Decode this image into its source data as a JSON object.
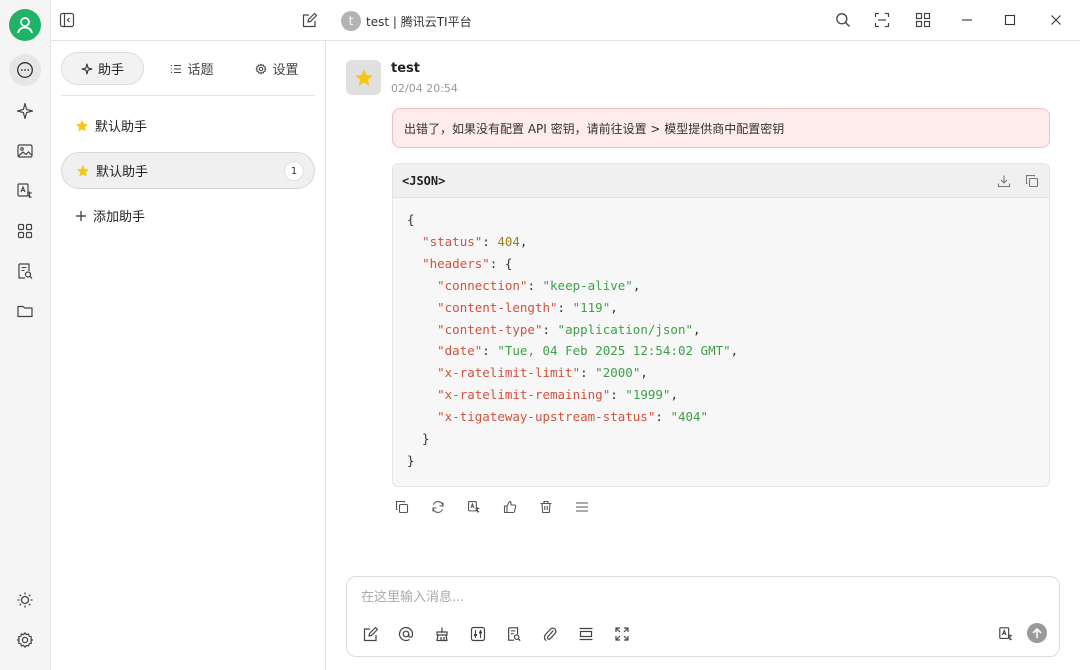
{
  "window": {
    "title": "test | 腾讯云TI平台",
    "title_avatar_letter": "t"
  },
  "rail": {
    "items": [
      "chat-icon",
      "sparkle-icon",
      "image-icon",
      "translate-icon",
      "apps-icon",
      "file-search-icon",
      "folder-icon"
    ],
    "bottom": [
      "sun-icon",
      "gear-icon"
    ]
  },
  "tabs": [
    {
      "label": "助手",
      "icon": "sparkle-icon",
      "active": true
    },
    {
      "label": "话题",
      "icon": "list-icon",
      "active": false
    },
    {
      "label": "设置",
      "icon": "gear-icon",
      "active": false
    }
  ],
  "assistants": [
    {
      "label": "默认助手",
      "badge": null,
      "active": false
    },
    {
      "label": "默认助手",
      "badge": "1",
      "active": true
    }
  ],
  "add_assistant_label": "添加助手",
  "message": {
    "name": "test",
    "time": "02/04 20:54",
    "error": "出错了，如果没有配置 API 密钥，请前往设置 > 模型提供商中配置密钥",
    "code_lang": "<JSON>",
    "code": {
      "status": "404",
      "headers": [
        {
          "key": "connection",
          "value": "keep-alive"
        },
        {
          "key": "content-length",
          "value": "119"
        },
        {
          "key": "content-type",
          "value": "application/json"
        },
        {
          "key": "date",
          "value": "Tue, 04 Feb 2025 12:54:02 GMT"
        },
        {
          "key": "x-ratelimit-limit",
          "value": "2000"
        },
        {
          "key": "x-ratelimit-remaining",
          "value": "1999"
        },
        {
          "key": "x-tigateway-upstream-status",
          "value": "404"
        }
      ]
    }
  },
  "input": {
    "placeholder": "在这里输入消息..."
  },
  "colors": {
    "brand": "#20b368",
    "error_bg": "#fdeceb",
    "json_key": "#d0533e",
    "json_string": "#3f9f49",
    "json_number": "#a07b20"
  }
}
